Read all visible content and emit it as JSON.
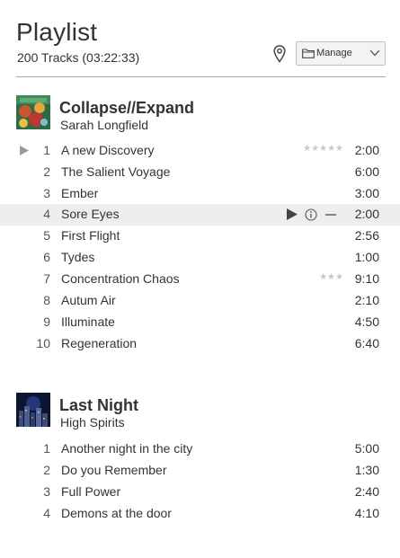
{
  "header": {
    "title": "Playlist",
    "track_summary": "200 Tracks (03:22:33)",
    "manage_label": "Manage"
  },
  "albums": [
    {
      "title": "Collapse//Expand",
      "artist": "Sarah Longfield",
      "tracks": [
        {
          "num": "1",
          "name": "A new Discovery",
          "duration": "2:00",
          "stars": "★★★★★"
        },
        {
          "num": "2",
          "name": "The Salient Voyage",
          "duration": "6:00"
        },
        {
          "num": "3",
          "name": "Ember",
          "duration": "3:00"
        },
        {
          "num": "4",
          "name": "Sore Eyes",
          "duration": "2:00"
        },
        {
          "num": "5",
          "name": "First Flight",
          "duration": "2:56"
        },
        {
          "num": "6",
          "name": "Tydes",
          "duration": "1:00"
        },
        {
          "num": "7",
          "name": "Concentration Chaos",
          "duration": "9:10",
          "stars": "★★★"
        },
        {
          "num": "8",
          "name": "Autum Air",
          "duration": "2:10"
        },
        {
          "num": "9",
          "name": "Illuminate",
          "duration": "4:50"
        },
        {
          "num": "10",
          "name": "Regeneration",
          "duration": "6:40"
        }
      ]
    },
    {
      "title": "Last Night",
      "artist": "High Spirits",
      "tracks": [
        {
          "num": "1",
          "name": "Another night in the city",
          "duration": "5:00"
        },
        {
          "num": "2",
          "name": "Do you Remember",
          "duration": "1:30"
        },
        {
          "num": "3",
          "name": "Full Power",
          "duration": "2:40"
        },
        {
          "num": "4",
          "name": "Demons at the door",
          "duration": "4:10"
        }
      ]
    }
  ],
  "colors": {
    "highlight_row": "#eeeeee",
    "divider": "#a8a8a8",
    "star_inactive": "#c7c7c7"
  },
  "icons": [
    "location-pin-icon",
    "folder-icon",
    "chevron-down-icon",
    "play-icon",
    "info-icon",
    "remove-icon"
  ]
}
